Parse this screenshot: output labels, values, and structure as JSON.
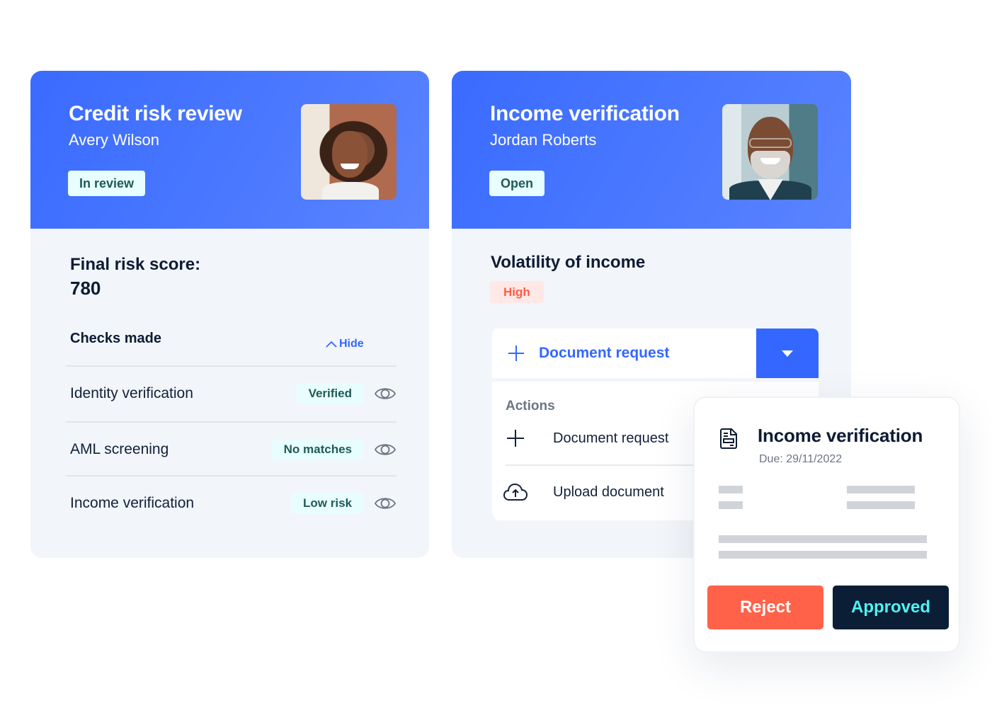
{
  "credit_card": {
    "title": "Credit risk review",
    "subtitle": "Avery Wilson",
    "status": "In review",
    "score_label": "Final risk score:",
    "score_value": "780",
    "checks_heading": "Checks made",
    "hide_label": "Hide",
    "checks": [
      {
        "label": "Identity verification",
        "badge": "Verified"
      },
      {
        "label": "AML screening",
        "badge": "No matches"
      },
      {
        "label": "Income verification",
        "badge": "Low risk"
      }
    ]
  },
  "income_card": {
    "title": "Income verification",
    "subtitle": "Jordan Roberts",
    "status": "Open",
    "volatility_title": "Volatility of income",
    "volatility_level": "High",
    "split_button_label": "Document request",
    "actions_heading": "Actions",
    "actions": [
      {
        "label": "Document request",
        "icon": "plus-icon"
      },
      {
        "label": "Upload document",
        "icon": "cloud-upload-icon"
      }
    ]
  },
  "task_card": {
    "icon": "document-icon",
    "title": "Income verification",
    "due": "Due: 29/11/2022",
    "reject_label": "Reject",
    "approve_label": "Approved"
  },
  "colors": {
    "primary_blue": "#3467ff",
    "header_gradient_start": "#3a6bff",
    "header_gradient_end": "#5a84ff",
    "badge_teal_bg": "#e8fdfd",
    "badge_teal_text": "#1f5a57",
    "high_badge_bg": "#ffe8e6",
    "high_badge_text": "#ff5c45",
    "reject": "#ff6249",
    "approve_bg": "#0b1e36",
    "approve_text": "#4ef3f3"
  }
}
